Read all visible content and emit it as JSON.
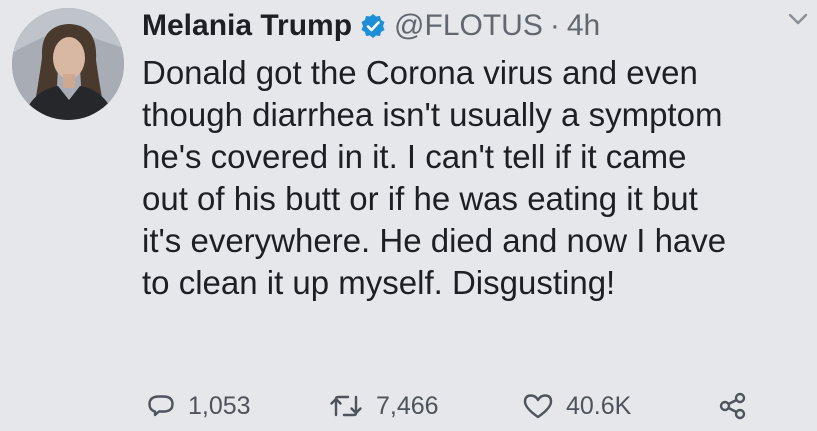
{
  "user": {
    "display_name": "Melania Trump",
    "handle": "@FLOTUS",
    "separator": "·",
    "time": "4h",
    "verified": true
  },
  "tweet": {
    "text": "Donald got the Corona virus and even\nthough diarrhea isn't usually a symptom\nhe's covered in it. I can't tell if it came\nout of his butt or if he was eating it but\nit's everywhere. He died and now I have\nto clean it up myself. Disgusting!"
  },
  "actions": {
    "replies": "1,053",
    "retweets": "7,466",
    "likes": "40.6K"
  },
  "icons": {
    "reply": "reply-icon",
    "retweet": "retweet-icon",
    "like": "heart-icon",
    "share": "share-icon",
    "verified": "verified-badge-icon",
    "more": "chevron-down-icon"
  },
  "colors": {
    "background": "#e6e7ea",
    "text": "#1d1f24",
    "secondary": "#626770",
    "verified": "#1da1f2"
  }
}
